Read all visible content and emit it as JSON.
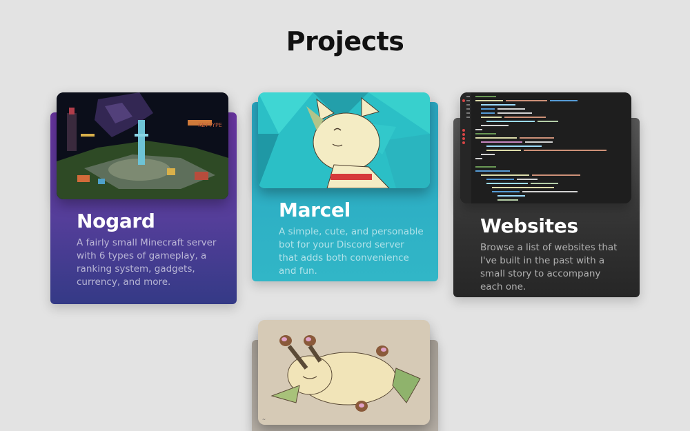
{
  "page": {
    "title": "Projects"
  },
  "projects": [
    {
      "title": "Nogard",
      "description": "A fairly small Minecraft server with 6 types of gameplay, a ranking system, gadgets, currency, and more.",
      "image_icon": "minecraft-server-screenshot"
    },
    {
      "title": "Marcel",
      "description": "A simple, cute, and personable bot for your Discord server that adds both convenience and fun.",
      "image_icon": "marcel-mascot-illustration"
    },
    {
      "title": "Websites",
      "description": "Browse a list of websites that I've built in the past with a small story to accompany each one.",
      "image_icon": "code-editor-screenshot"
    },
    {
      "title": "",
      "description": "",
      "image_icon": "sleeping-leafeon-drawing"
    }
  ],
  "colors": {
    "background": "#e3e3e3",
    "nogard": "#553e9a",
    "marcel": "#2aa7c1",
    "websites": "#333333"
  }
}
